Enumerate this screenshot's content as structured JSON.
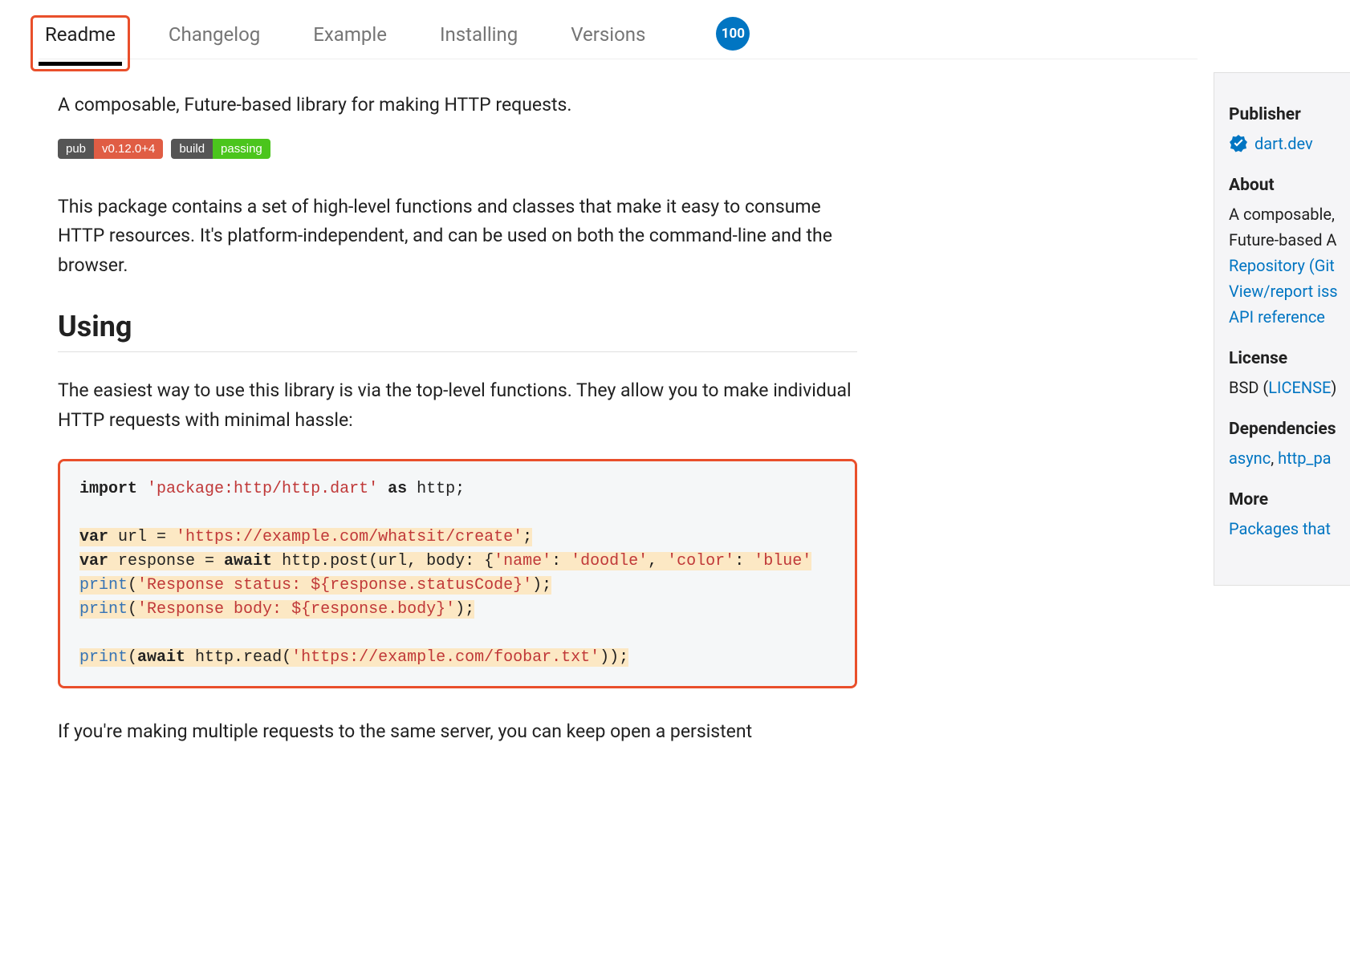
{
  "tabs": {
    "readme": "Readme",
    "changelog": "Changelog",
    "example": "Example",
    "installing": "Installing",
    "versions": "Versions",
    "score": "100"
  },
  "content": {
    "intro": "A composable, Future-based library for making HTTP requests.",
    "badge_pub_label": "pub",
    "badge_pub_value": "v0.12.0+4",
    "badge_build_label": "build",
    "badge_build_value": "passing",
    "description": "This package contains a set of high-level functions and classes that make it easy to consume HTTP resources. It's platform-independent, and can be used on both the command-line and the browser.",
    "heading_using": "Using",
    "usage_desc": "The easiest way to use this library is via the top-level functions. They allow you to make individual HTTP requests with minimal hassle:",
    "code": {
      "import_kw": "import",
      "import_str": "'package:http/http.dart'",
      "as_kw": "as",
      "as_name": " http;",
      "var1": "var",
      "url_assign": " url = ",
      "url_str": "'https://example.com/whatsit/create'",
      "url_end": ";",
      "var2": "var",
      "resp_assign": " response = ",
      "await_kw": "await",
      "post_call": " http.post(url, body: {",
      "name_key": "'name'",
      "name_sep": ": ",
      "name_val": "'doodle'",
      "comma1": ", ",
      "color_key": "'color'",
      "color_sep": ": ",
      "color_val": "'blue'",
      "print1": "print",
      "print1_open": "(",
      "print1_str": "'Response status: ${response.statusCode}'",
      "print1_close": ");",
      "print2": "print",
      "print2_open": "(",
      "print2_str": "'Response body: ${response.body}'",
      "print2_close": ");",
      "print3": "print",
      "print3_open": "(",
      "await3": "await",
      "read_call": " http.read(",
      "read_str": "'https://example.com/foobar.txt'",
      "read_close": "));"
    },
    "after_code": "If you're making multiple requests to the same server, you can keep open a persistent"
  },
  "sidebar": {
    "publisher_heading": "Publisher",
    "publisher_link": "dart.dev",
    "about_heading": "About",
    "about_text1": "A composable,",
    "about_text2": "Future-based A",
    "repo_link": "Repository (Git",
    "issues_link": "View/report iss",
    "api_link": "API reference",
    "license_heading": "License",
    "license_prefix": "BSD (",
    "license_link": "LICENSE",
    "license_suffix": ")",
    "deps_heading": "Dependencies",
    "dep1": "async",
    "dep_sep": ", ",
    "dep2": "http_pa",
    "more_heading": "More",
    "more_link": "Packages that"
  }
}
